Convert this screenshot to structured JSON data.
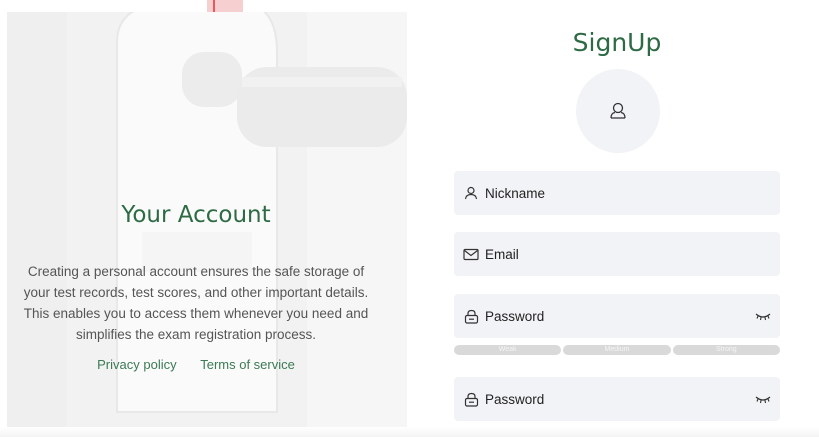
{
  "left": {
    "title": "Your Account",
    "description": "Creating a personal account ensures the safe storage of your test records, test scores, and other important details. This enables you to access them whenever you need and simplifies the exam registration process.",
    "privacy_link": "Privacy policy",
    "terms_link": "Terms of service"
  },
  "signup": {
    "title": "SignUp",
    "fields": {
      "nickname": "Nickname",
      "email": "Email",
      "password": "Password",
      "confirm_password": "Password"
    },
    "strength": [
      "Weak",
      "Medium",
      "Strong"
    ]
  },
  "colors": {
    "accent": "#2e6b45",
    "field_bg": "#f2f3f6"
  },
  "icons": [
    "user-icon",
    "mail-icon",
    "lock-icon",
    "eye-closed-icon",
    "avatar-icon"
  ]
}
